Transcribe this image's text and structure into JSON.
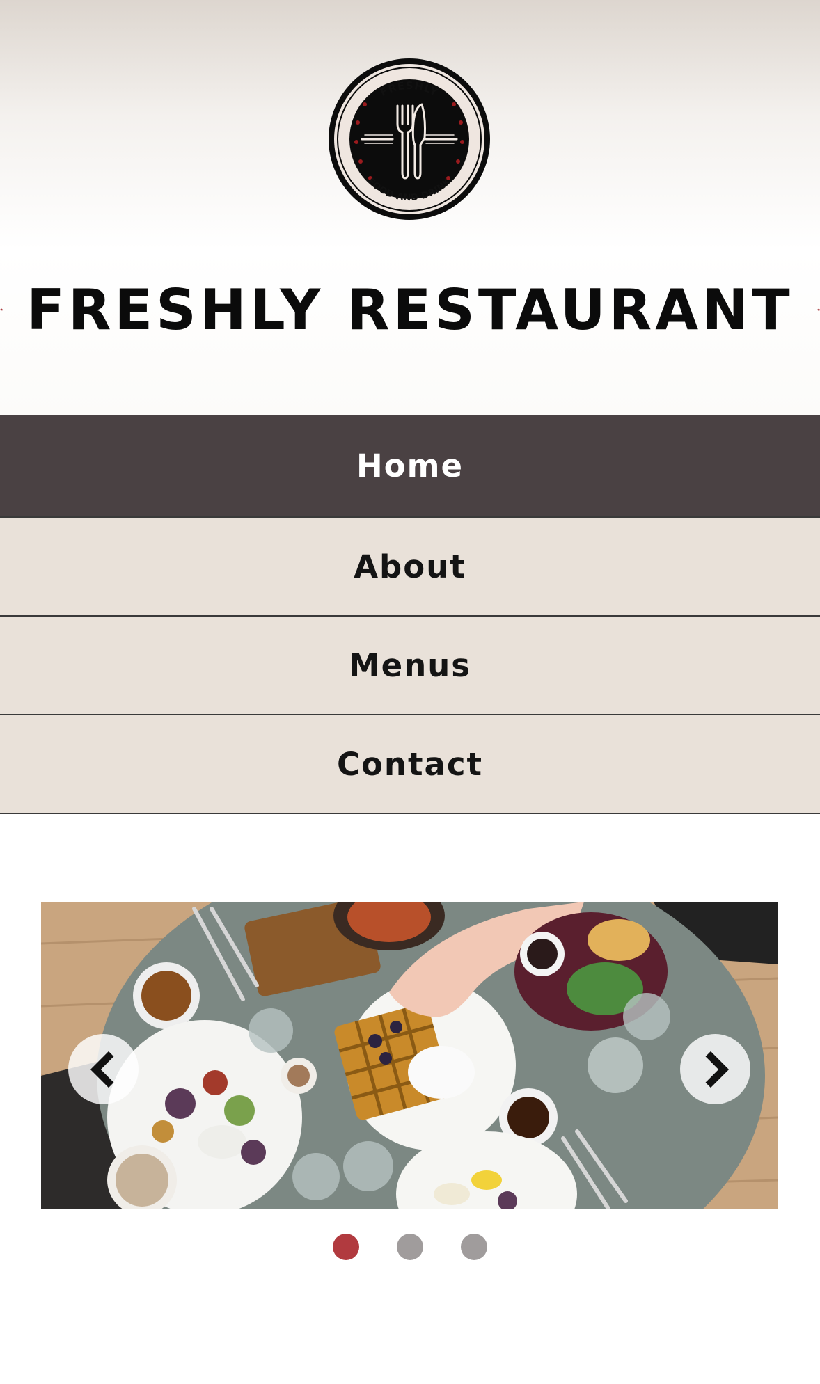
{
  "logo": {
    "top_text": "FRESHLY",
    "bottom_text": "FOOD AND DRINK",
    "icon": "fork-knife-icon"
  },
  "site_title": "FRESHLY RESTAURANT",
  "nav": {
    "items": [
      {
        "label": "Home",
        "active": true
      },
      {
        "label": "About",
        "active": false
      },
      {
        "label": "Menus",
        "active": false
      },
      {
        "label": "Contact",
        "active": false
      }
    ]
  },
  "carousel": {
    "prev_icon": "chevron-left-icon",
    "next_icon": "chevron-right-icon",
    "slide_count": 3,
    "active_index": 0
  },
  "colors": {
    "accent_red": "#9b1b1e",
    "nav_active_bg": "#4a4143",
    "nav_bg": "#e9e1d9",
    "dot_active": "#b13a3f",
    "dot_inactive": "#a09c9c"
  }
}
